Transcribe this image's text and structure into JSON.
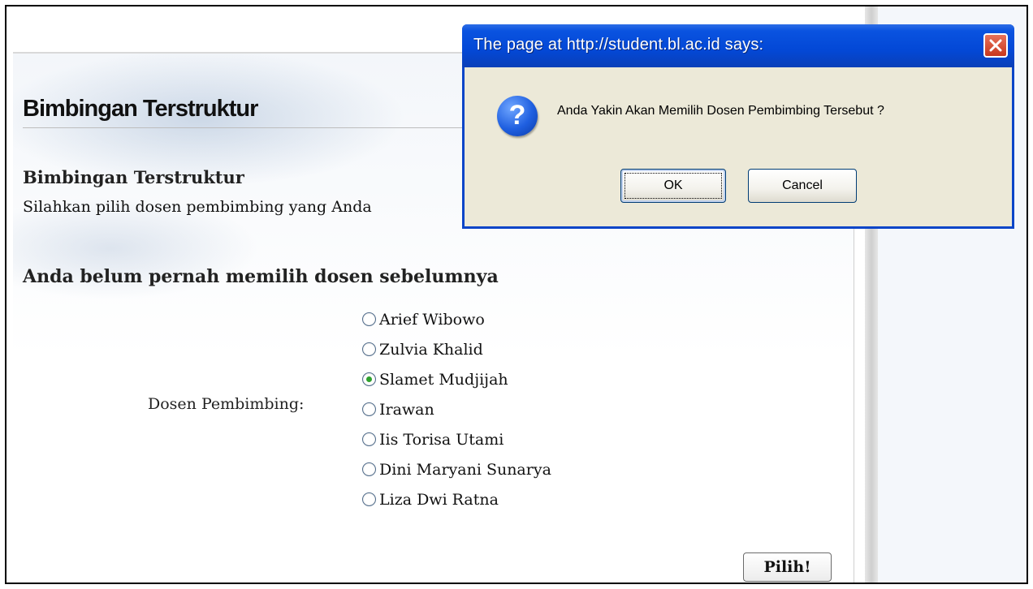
{
  "page": {
    "title": "Bimbingan Terstruktur",
    "section_title": "Bimbingan Terstruktur",
    "instruction": "Silahkan pilih dosen pembimbing yang Anda",
    "notice": "Anda belum pernah memilih dosen sebelumnya",
    "field_label": "Dosen Pembimbing:",
    "options": [
      {
        "label": "Arief Wibowo",
        "checked": false
      },
      {
        "label": "Zulvia Khalid",
        "checked": false
      },
      {
        "label": "Slamet Mudjijah",
        "checked": true
      },
      {
        "label": "Irawan",
        "checked": false
      },
      {
        "label": "Iis Torisa Utami",
        "checked": false
      },
      {
        "label": "Dini Maryani Sunarya",
        "checked": false
      },
      {
        "label": "Liza Dwi Ratna",
        "checked": false
      }
    ],
    "submit_label": "Pilih!"
  },
  "dialog": {
    "title": "The page at http://student.bl.ac.id says:",
    "message": "Anda Yakin Akan Memilih Dosen Pembimbing Tersebut ?",
    "icon": "question-icon",
    "ok_label": "OK",
    "cancel_label": "Cancel"
  }
}
